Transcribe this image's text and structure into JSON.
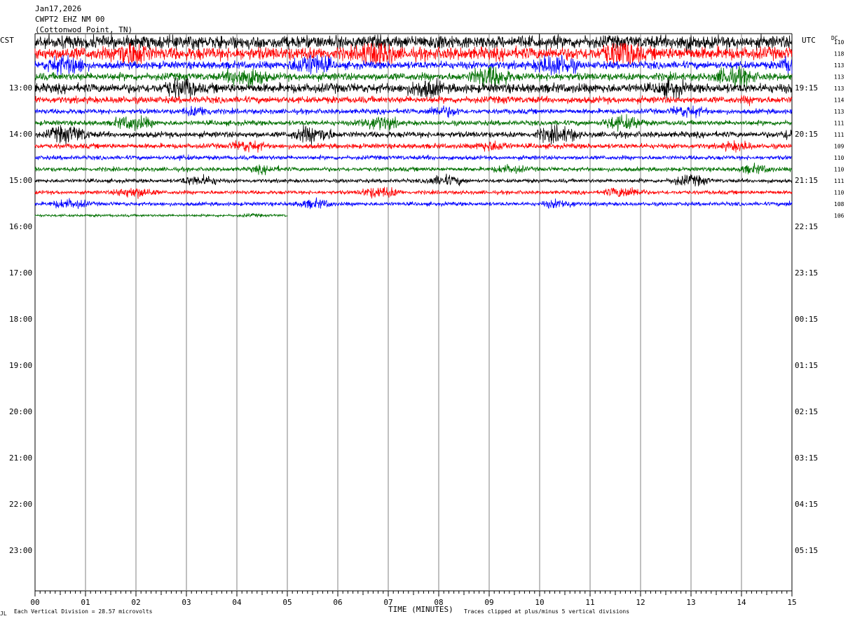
{
  "header": {
    "date": "Jan17,2026",
    "station": "CWPT2 EHZ NM 00",
    "location": "(Cottonwod Point, TN)"
  },
  "left_tz": "CST",
  "right_tz": "UTC",
  "dc_label": "DC",
  "footer": {
    "scale_note": "Each Vertical Division =   28.57 microvolts",
    "clip_note": "Traces clipped at plus/minus 5 vertical divisions",
    "corner_mark": "JL"
  },
  "colors": {
    "cycle": [
      "#000000",
      "#ff0000",
      "#0000ff",
      "#007000"
    ],
    "grid": "#808080"
  },
  "chart_data": {
    "type": "helicorder",
    "xlabel": "TIME (MINUTES)",
    "x_ticks": [
      "00",
      "01",
      "02",
      "03",
      "04",
      "05",
      "06",
      "07",
      "08",
      "09",
      "10",
      "11",
      "12",
      "13",
      "14",
      "15"
    ],
    "x_range": [
      0,
      15
    ],
    "left_hour_labels": [
      "13:00",
      "14:00",
      "15:00",
      "16:00",
      "17:00",
      "18:00",
      "19:00",
      "20:00",
      "21:00",
      "22:00",
      "23:00"
    ],
    "right_hour_labels": [
      "19:15",
      "20:15",
      "21:15",
      "22:15",
      "23:15",
      "00:15",
      "01:15",
      "02:15",
      "03:15",
      "04:15",
      "05:15"
    ],
    "rows_per_hour": 4,
    "row_minutes": 15,
    "traces": [
      {
        "color": "#000000",
        "dc": "110",
        "amp": 1.5,
        "end_minute": 15
      },
      {
        "color": "#ff0000",
        "dc": "118",
        "amp": 1.5,
        "end_minute": 15
      },
      {
        "color": "#0000ff",
        "dc": "113",
        "amp": 0.9,
        "end_minute": 15
      },
      {
        "color": "#007000",
        "dc": "113",
        "amp": 0.9,
        "end_minute": 15
      },
      {
        "color": "#000000",
        "dc": "113",
        "amp": 1.1,
        "end_minute": 15
      },
      {
        "color": "#ff0000",
        "dc": "114",
        "amp": 0.8,
        "end_minute": 15
      },
      {
        "color": "#0000ff",
        "dc": "113",
        "amp": 0.6,
        "end_minute": 15
      },
      {
        "color": "#007000",
        "dc": "111",
        "amp": 0.6,
        "end_minute": 15
      },
      {
        "color": "#000000",
        "dc": "111",
        "amp": 0.7,
        "end_minute": 15
      },
      {
        "color": "#ff0000",
        "dc": "109",
        "amp": 0.6,
        "end_minute": 15
      },
      {
        "color": "#0000ff",
        "dc": "110",
        "amp": 0.5,
        "end_minute": 15
      },
      {
        "color": "#007000",
        "dc": "110",
        "amp": 0.5,
        "end_minute": 15
      },
      {
        "color": "#000000",
        "dc": "111",
        "amp": 0.45,
        "end_minute": 15
      },
      {
        "color": "#ff0000",
        "dc": "110",
        "amp": 0.45,
        "end_minute": 15
      },
      {
        "color": "#0000ff",
        "dc": "108",
        "amp": 0.45,
        "end_minute": 15
      },
      {
        "color": "#007000",
        "dc": "106",
        "amp": 0.3,
        "end_minute": 5
      }
    ],
    "scale_microvolts_per_division": 28.57,
    "clip_divisions": 5
  }
}
